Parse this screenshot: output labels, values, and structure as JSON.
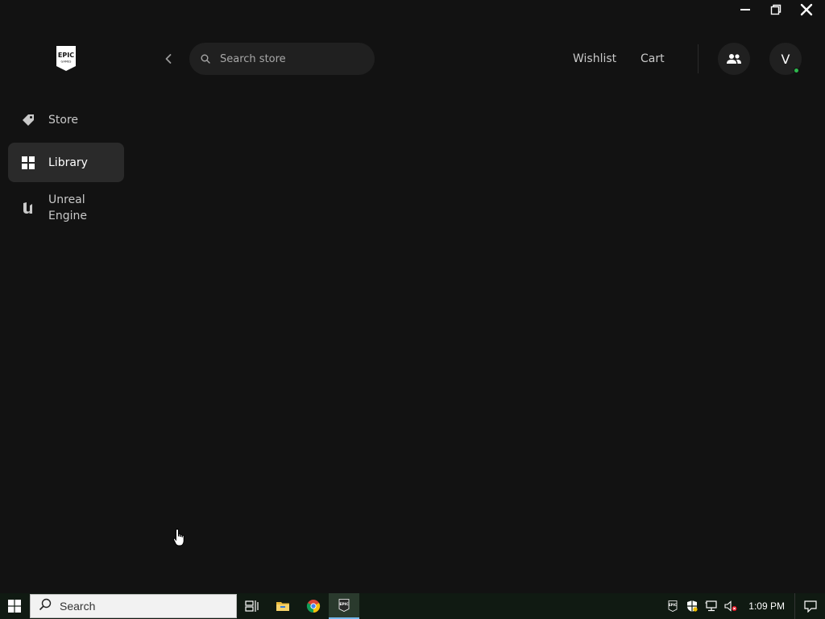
{
  "app": {
    "logo_text_line1": "EPIC",
    "logo_text_line2": "GAMES"
  },
  "window_controls": [
    "minimize-icon",
    "restore-icon",
    "close-icon"
  ],
  "sidebar": {
    "items": [
      {
        "label": "Store",
        "icon": "tag-icon",
        "active": false
      },
      {
        "label": "Library",
        "icon": "grid-icon",
        "active": true
      },
      {
        "label": "Unreal Engine",
        "icon": "unreal-icon",
        "active": false
      }
    ]
  },
  "header": {
    "search_placeholder": "Search store",
    "wishlist_label": "Wishlist",
    "cart_label": "Cart",
    "avatar_initial": "V"
  },
  "taskbar": {
    "search_placeholder": "Search",
    "clock": "1:09 PM",
    "tray_epic_label": "EPIC",
    "active_app_label": "EPIC"
  },
  "colors": {
    "background": "#121212",
    "active_nav": "#2a2a2a",
    "online_status": "#2db84d",
    "taskbar": "#101a12"
  }
}
